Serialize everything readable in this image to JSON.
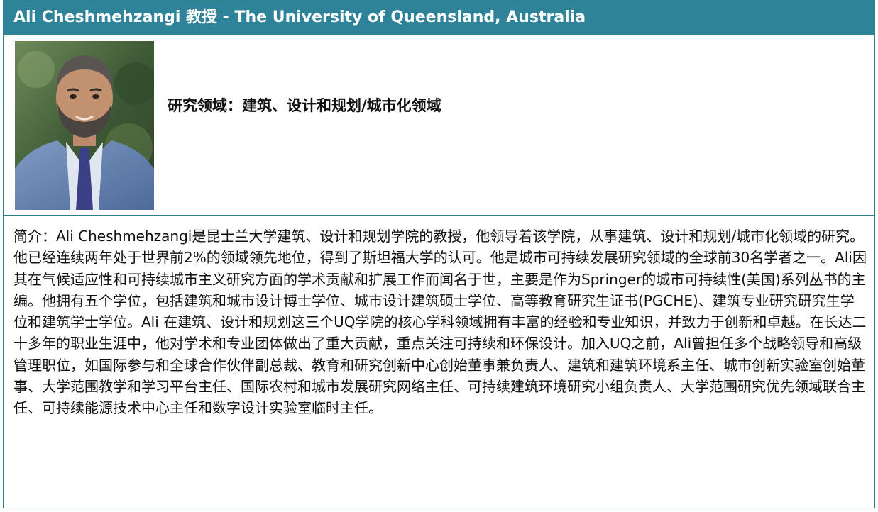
{
  "header": {
    "title": "Ali Cheshmehzangi 教授 - The University of Queensland, Australia"
  },
  "profile": {
    "field_label": "研究领域：建筑、设计和规划/城市化领域"
  },
  "bio": {
    "text": "简介：Ali Cheshmehzangi是昆士兰大学建筑、设计和规划学院的教授，他领导着该学院，从事建筑、设计和规划/城市化领域的研究。他已经连续两年处于世界前2%的领域领先地位，得到了斯坦福大学的认可。他是城市可持续发展研究领域的全球前30名学者之一。Ali因其在气候适应性和可持续城市主义研究方面的学术贡献和扩展工作而闻名于世，主要是作为Springer的城市可持续性(美国)系列丛书的主编。他拥有五个学位，包括建筑和城市设计博士学位、城市设计建筑硕士学位、高等教育研究生证书(PGCHE)、建筑专业研究研究生学位和建筑学士学位。Ali 在建筑、设计和规划这三个UQ学院的核心学科领域拥有丰富的经验和专业知识，并致力于创新和卓越。在长达二十多年的职业生涯中，他对学术和专业团体做出了重大贡献，重点关注可持续和环保设计。加入UQ之前，Ali曾担任多个战略领导和高级管理职位，如国际参与和全球合作伙伴副总裁、教育和研究创新中心创始董事兼负责人、建筑和建筑环境系主任、城市创新实验室创始董事、大学范围教学和学习平台主任、国际农村和城市发展研究网络主任、可持续建筑环境研究小组负责人、大学范围研究优先领域联合主任、可持续能源技术中心主任和数字设计实验室临时主任。"
  },
  "colors": {
    "header_bg": "#2f8398",
    "border": "#2f7f8f"
  }
}
